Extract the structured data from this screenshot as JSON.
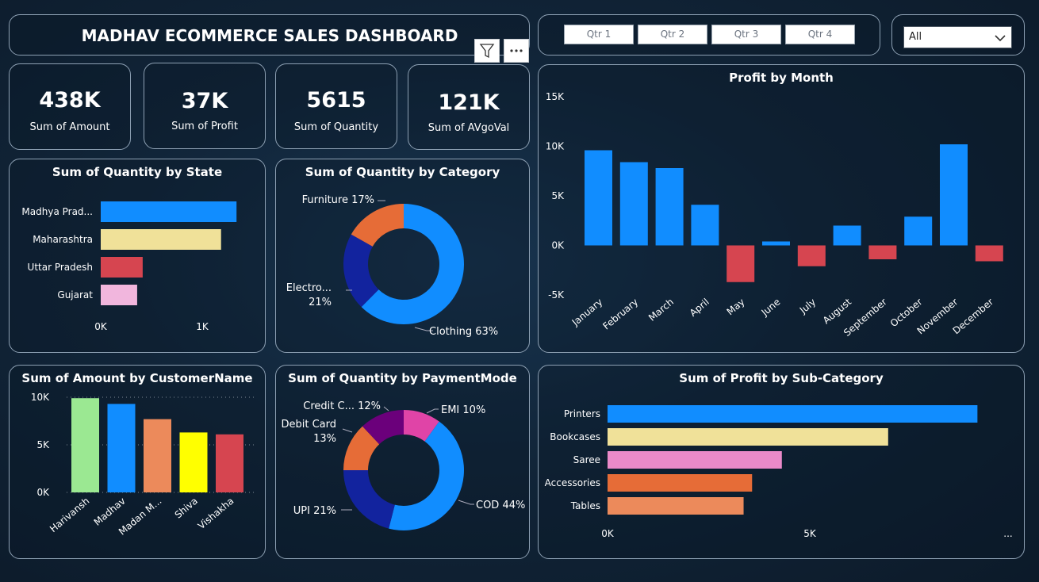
{
  "header": {
    "title": "MADHAV ECOMMERCE SALES DASHBOARD"
  },
  "slicer": {
    "quarters": [
      "Qtr 1",
      "Qtr 2",
      "Qtr 3",
      "Qtr 4"
    ],
    "dropdown_value": "All"
  },
  "kpis": [
    {
      "value": "438K",
      "label": "Sum of Amount"
    },
    {
      "value": "37K",
      "label": "Sum of Profit"
    },
    {
      "value": "5615",
      "label": "Sum of Quantity"
    },
    {
      "value": "121K",
      "label": "Sum of AVgoVal"
    }
  ],
  "icons": {
    "filter": "filter-icon",
    "more": "more-options-icon",
    "chevron": "chevron-down-icon"
  },
  "colors": {
    "blue": "#118dff",
    "navy": "#12239e",
    "orange": "#e66c37",
    "purple": "#6b007b",
    "magenta": "#e044a7",
    "red": "#d64550",
    "khaki": "#f0e199",
    "pink": "#f1b6dd",
    "green": "#9be892",
    "yellow": "#ffff00",
    "salmon": "#ec8a5b",
    "pinkbar": "#ea8ac9"
  },
  "chart_data": [
    {
      "id": "state",
      "type": "bar",
      "orientation": "horizontal",
      "title": "Sum of Quantity by State",
      "categories": [
        "Madhya Prad...",
        "Maharashtra",
        "Uttar Pradesh",
        "Gujarat"
      ],
      "values": [
        1230,
        1090,
        380,
        330
      ],
      "x_ticks": [
        "0K",
        "1K"
      ],
      "xlim": [
        0,
        1250
      ]
    },
    {
      "id": "category",
      "type": "pie",
      "donut": true,
      "title": "Sum of Quantity by Category",
      "slices": [
        {
          "name": "Clothing",
          "value": 63,
          "label": "Clothing 63%"
        },
        {
          "name": "Electronics",
          "value": 21,
          "label_line1": "Electro...",
          "label_line2": "21%"
        },
        {
          "name": "Furniture",
          "value": 17,
          "label": "Furniture 17%"
        }
      ]
    },
    {
      "id": "month",
      "type": "bar",
      "title": "Profit by Month",
      "categories": [
        "January",
        "February",
        "March",
        "April",
        "May",
        "June",
        "July",
        "August",
        "September",
        "October",
        "November",
        "December"
      ],
      "values": [
        9600,
        8400,
        7800,
        4100,
        -3700,
        400,
        -2100,
        2000,
        -1400,
        2900,
        10200,
        -1600
      ],
      "y_ticks": [
        "15K",
        "10K",
        "5K",
        "0K",
        "-5K"
      ],
      "ylim": [
        -5000,
        15000
      ]
    },
    {
      "id": "customer",
      "type": "bar",
      "title": "Sum of Amount by CustomerName",
      "categories": [
        "Harivansh",
        "Madhav",
        "Madan M...",
        "Shiva",
        "Vishakha"
      ],
      "values": [
        9900,
        9300,
        7700,
        6300,
        6100
      ],
      "y_ticks": [
        "10K",
        "5K",
        "0K"
      ],
      "ylim": [
        0,
        10000
      ],
      "grid": true
    },
    {
      "id": "payment",
      "type": "pie",
      "donut": true,
      "title": "Sum of Quantity by PaymentMode",
      "slices": [
        {
          "name": "COD",
          "value": 44,
          "label": "COD 44%"
        },
        {
          "name": "UPI",
          "value": 21,
          "label": "UPI 21%"
        },
        {
          "name": "Debit Card",
          "value": 13,
          "label_line1": "Debit Card",
          "label_line2": "13%"
        },
        {
          "name": "Credit Card",
          "value": 12,
          "label": "Credit C... 12%"
        },
        {
          "name": "EMI",
          "value": 10,
          "label": "EMI 10%"
        }
      ]
    },
    {
      "id": "subcat",
      "type": "bar",
      "orientation": "horizontal",
      "title": "Sum of Profit by Sub-Category",
      "categories": [
        "Printers",
        "Bookcases",
        "Saree",
        "Accessories",
        "Tables"
      ],
      "values": [
        8700,
        6600,
        4100,
        3400,
        3200
      ],
      "x_ticks": [
        "0K",
        "5K"
      ],
      "xlim": [
        0,
        9000
      ],
      "more_marker": "..."
    }
  ]
}
